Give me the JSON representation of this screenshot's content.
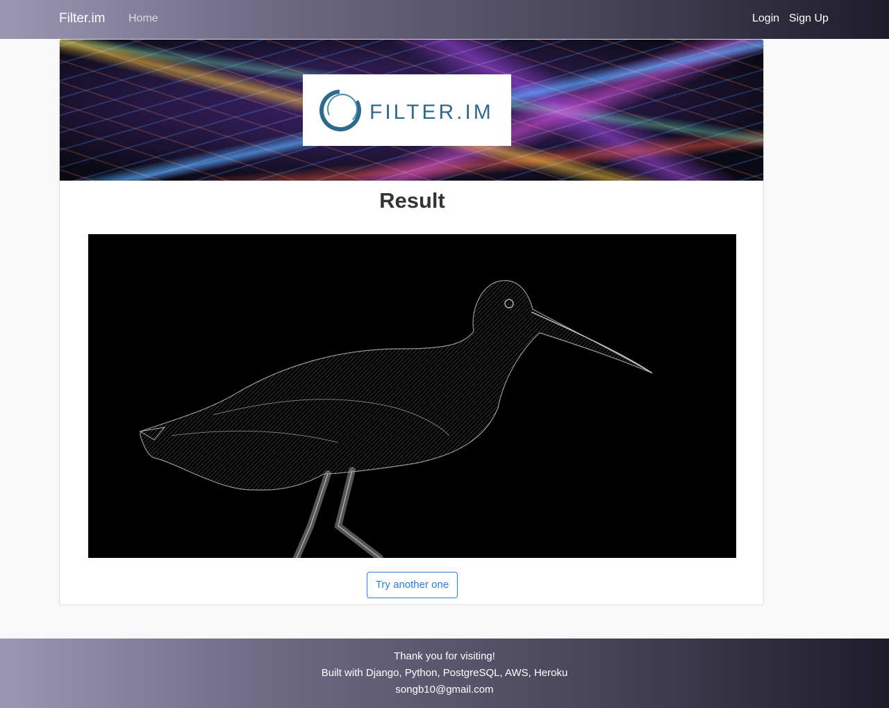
{
  "navbar": {
    "brand": "Filter.im",
    "home_label": "Home",
    "login_label": "Login",
    "signup_label": "Sign Up"
  },
  "banner": {
    "logo_text": "FILTER.IM"
  },
  "main": {
    "title": "Result",
    "try_button_label": "Try another one"
  },
  "footer": {
    "line1": "Thank you for visiting!",
    "line2": "Built with Django, Python, PostgreSQL, AWS, Heroku",
    "email": "songb10@gmail.com"
  },
  "colors": {
    "accent": "#2c7be5",
    "logo_blue": "#2d6a8c"
  }
}
